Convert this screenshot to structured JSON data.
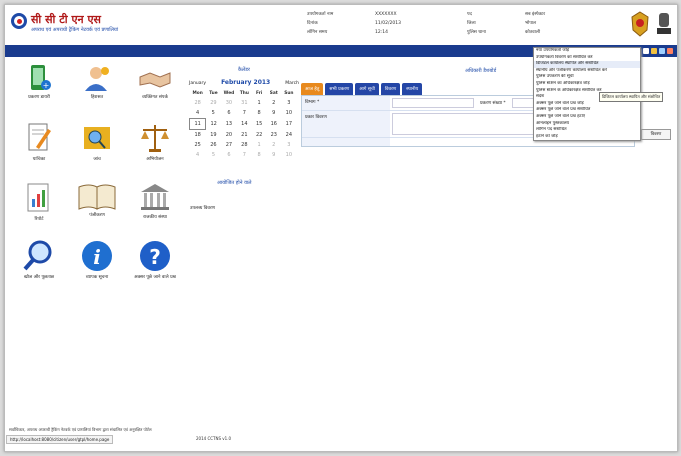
{
  "header": {
    "title": "सी सी टी एन एस",
    "subtitle": "अपराध एवं अपराधी ट्रैकिंग नेटवर्क एवं प्रणालियां",
    "meta_left": [
      {
        "k": "उपयोगकर्ता नाम",
        "v": "XXXXXXX"
      },
      {
        "k": "दिनांक",
        "v": "11/02/2013"
      },
      {
        "k": "लॉगिन समय",
        "v": "12:14"
      }
    ],
    "meta_right": [
      {
        "k": "पद",
        "v": "सब इंस्पेक्टर"
      },
      {
        "k": "जिला",
        "v": "भोपाल"
      },
      {
        "k": "पुलिस थाना",
        "v": "कोतवाली"
      }
    ]
  },
  "tiles": [
    {
      "label": "प्रकरण डायरी",
      "icon": "mobile-device-icon"
    },
    {
      "label": "हिरासत",
      "icon": "person-icon"
    },
    {
      "label": "व्यक्तिगत संपर्क",
      "icon": "handshake-icon"
    },
    {
      "label": "याचिका",
      "icon": "document-pencil-icon"
    },
    {
      "label": "जांच",
      "icon": "folder-search-icon"
    },
    {
      "label": "अभियोजन",
      "icon": "scales-icon"
    },
    {
      "label": "रिपोर्ट",
      "icon": "report-chart-icon"
    },
    {
      "label": "पंजीकरण",
      "icon": "open-book-icon"
    },
    {
      "label": "राजकीय संस्था",
      "icon": "government-building-icon"
    },
    {
      "label": "खोज और पूछताछ",
      "icon": "magnifier-icon"
    },
    {
      "label": "व्यापक सूचना",
      "icon": "info-icon"
    },
    {
      "label": "अक्सर पूछे जाने वाले प्रश्न",
      "icon": "question-icon"
    }
  ],
  "calendar": {
    "title": "कैलेंडर",
    "prev": "January",
    "current": "February 2013",
    "next": "March",
    "dow": [
      "Mon",
      "Tue",
      "Wed",
      "Thu",
      "Fri",
      "Sat",
      "Sun"
    ],
    "weeks": [
      [
        "28",
        "29",
        "30",
        "31",
        "1",
        "2",
        "3"
      ],
      [
        "4",
        "5",
        "6",
        "7",
        "8",
        "9",
        "10"
      ],
      [
        "11",
        "12",
        "13",
        "14",
        "15",
        "16",
        "17"
      ],
      [
        "18",
        "19",
        "20",
        "21",
        "22",
        "23",
        "24"
      ],
      [
        "25",
        "26",
        "27",
        "28",
        "1",
        "2",
        "3"
      ],
      [
        "4",
        "5",
        "6",
        "7",
        "8",
        "9",
        "10"
      ]
    ],
    "today": "11"
  },
  "quick_link": "आयोजित होने वाले",
  "quick_text": "उपलब्ध विवरण",
  "panel": {
    "title": "अधिकारी डैशबोर्ड",
    "tabs": [
      "आज हेतु",
      "सभी प्रकरण",
      "आगे सूची",
      "विवरण",
      "स्थानीय"
    ],
    "fields": [
      {
        "label": "विभाग *",
        "side_label": "प्रकरण संख्या *"
      },
      {
        "label": "प्रकार विवरण",
        "side_label": ""
      }
    ],
    "side_button": "विवरण"
  },
  "dropdown": {
    "items": [
      "नया उपयोगकर्ता जोड़ें",
      "उपयोगकर्ता विवरण को संशोधित करें",
      "डिजिटल कार्यालय स्थापित और संशोधित",
      "स्थानीय और पंजीकरण कार्यालय संशोधित करें",
      "पुलिस उपकरण की सूची",
      "पुलिस स्टेशन का अधिकारक्षेत्र जोड़ें",
      "पुलिस स्टेशन के अधिकारक्षेत्र संशोधित करें",
      "संदेश",
      "अक्सर पूछे जाने वाले प्रश्न जोड़ें",
      "अक्सर पूछे जाने वाले प्रश्न संशोधित",
      "अक्सर पूछे जाने वाले प्रश्न हटाएं",
      "ऑनलाइन पुस्तकालय",
      "लॉगिन पद संशोधित",
      "हटाने को जोड़ें"
    ],
    "highlight_index": 2,
    "tooltip": "डिजिटल कार्यालय स्थापित और संशोधित"
  },
  "footer": {
    "text": "सर्वाधिकार, अपराध अपराधी ट्रैकिंग नेटवर्क एवं प्रणालियां विभाग द्वारा संचालित एवं अनुरक्षित पोर्टल",
    "status_url": "http://localhost:8080/citizen/user/gtpl/home.page",
    "version": "2014 CCTNS v1.0"
  },
  "colors": {
    "nav": "#1a3b8e",
    "accent": "#e8891d",
    "brand": "#b01818",
    "link": "#1e4aa8"
  }
}
